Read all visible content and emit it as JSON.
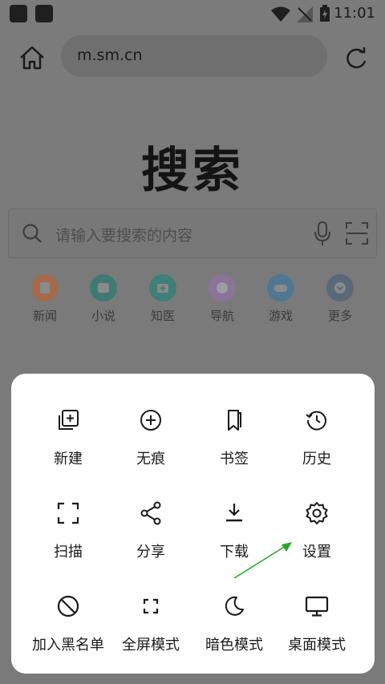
{
  "status_bar": {
    "time": "11:01"
  },
  "browser": {
    "url": "m.sm.cn"
  },
  "page": {
    "logo_text": "搜索",
    "search_placeholder": "请输入要搜索的内容",
    "quick_links": [
      {
        "label": "新闻",
        "icon": "news-icon",
        "color": "#a36a4e"
      },
      {
        "label": "小说",
        "icon": "book-icon",
        "color": "#3f7a72"
      },
      {
        "label": "知医",
        "icon": "medical-kit-icon",
        "color": "#3e7f78"
      },
      {
        "label": "导航",
        "icon": "compass-icon",
        "color": "#8a7497"
      },
      {
        "label": "游戏",
        "icon": "gamepad-icon",
        "color": "#4f7794"
      },
      {
        "label": "更多",
        "icon": "more-chevron-icon",
        "color": "#59687a"
      }
    ]
  },
  "menu": {
    "items": [
      {
        "label": "新建",
        "icon": "new-tab-icon"
      },
      {
        "label": "无痕",
        "icon": "incognito-plus-icon"
      },
      {
        "label": "书签",
        "icon": "bookmark-icon"
      },
      {
        "label": "历史",
        "icon": "history-icon"
      },
      {
        "label": "扫描",
        "icon": "scan-frame-icon"
      },
      {
        "label": "分享",
        "icon": "share-icon"
      },
      {
        "label": "下载",
        "icon": "download-icon"
      },
      {
        "label": "设置",
        "icon": "gear-icon"
      },
      {
        "label": "加入黑名单",
        "icon": "block-icon"
      },
      {
        "label": "全屏模式",
        "icon": "fullscreen-icon"
      },
      {
        "label": "暗色模式",
        "icon": "moon-icon"
      },
      {
        "label": "桌面模式",
        "icon": "desktop-icon"
      }
    ]
  },
  "colors": {
    "overlay": "#7b7b7b",
    "sheet": "#ffffff",
    "annotation_arrow": "#22aa22"
  }
}
